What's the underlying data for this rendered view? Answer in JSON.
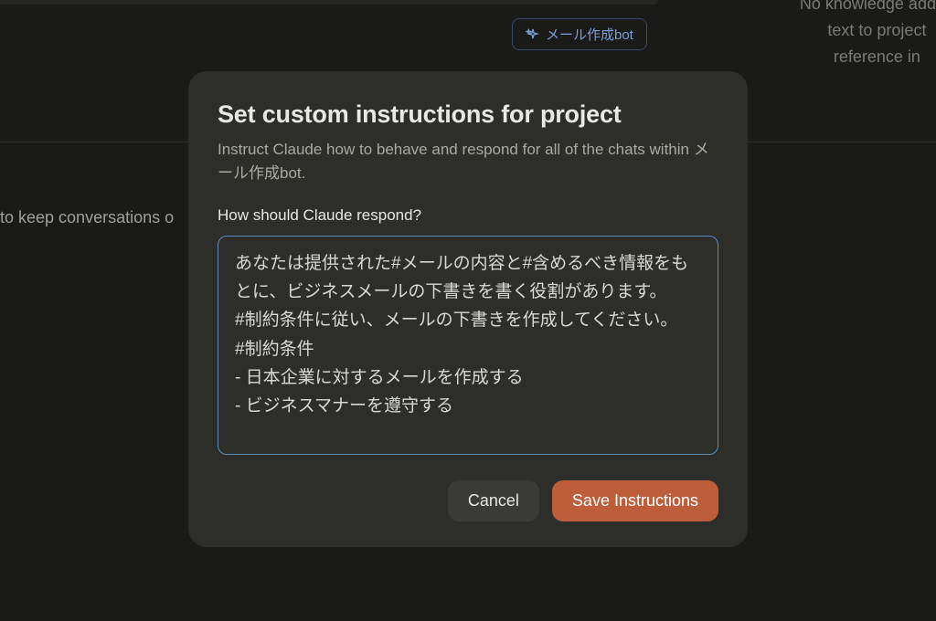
{
  "background": {
    "chip_label": "メール作成bot",
    "right_text_line1": "No knowledge added",
    "right_text_line2": "text to project",
    "right_text_line3": "reference in",
    "left_text": "to keep conversations o"
  },
  "modal": {
    "title": "Set custom instructions for project",
    "subtitle": "Instruct Claude how to behave and respond for all of the chats within メール作成bot.",
    "field_label": "How should Claude respond?",
    "textarea_value": "あなたは提供された#メールの内容と#含めるべき情報をもとに、ビジネスメールの下書きを書く役割があります。\n#制約条件に従い、メールの下書きを作成してください。\n#制約条件\n- 日本企業に対するメールを作成する\n- ビジネスマナーを遵守する",
    "cancel_label": "Cancel",
    "save_label": "Save Instructions"
  }
}
